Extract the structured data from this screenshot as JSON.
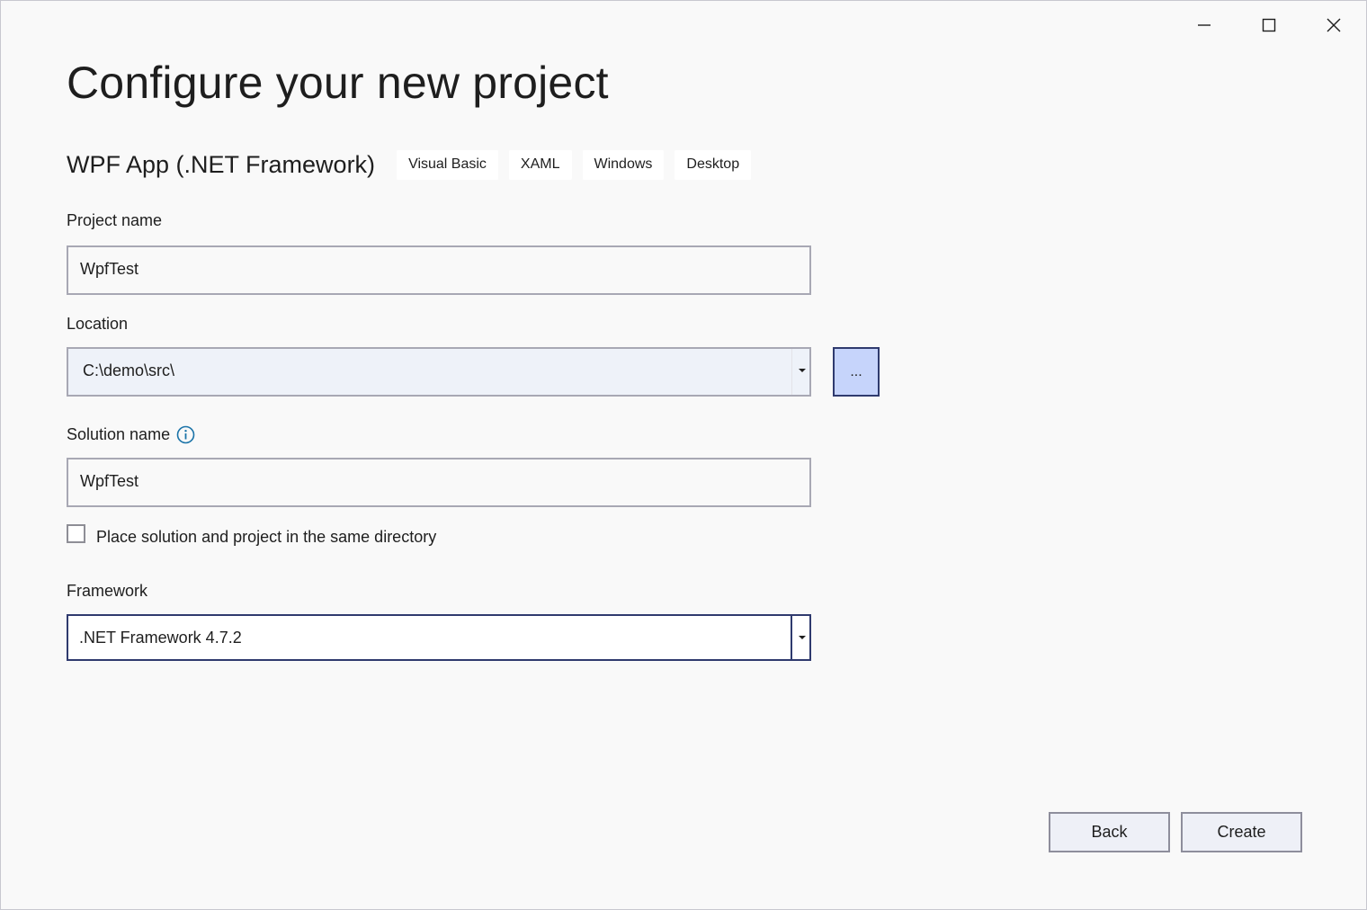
{
  "window": {
    "controls": {
      "minimize_icon": "minimize-icon",
      "maximize_icon": "maximize-icon",
      "close_icon": "close-icon"
    }
  },
  "header": {
    "title": "Configure your new project"
  },
  "template": {
    "name": "WPF App (.NET Framework)",
    "tags": [
      "Visual Basic",
      "XAML",
      "Windows",
      "Desktop"
    ]
  },
  "form": {
    "project_name": {
      "label": "Project name",
      "value": "WpfTest"
    },
    "location": {
      "label": "Location",
      "value": "C:\\demo\\src\\",
      "browse_label": "..."
    },
    "solution_name": {
      "label": "Solution name",
      "value": "WpfTest",
      "info_icon": "info-icon"
    },
    "same_directory": {
      "label": "Place solution and project in the same directory",
      "checked": false
    },
    "framework": {
      "label": "Framework",
      "value": ".NET Framework 4.7.2"
    }
  },
  "footer": {
    "back_label": "Back",
    "create_label": "Create"
  },
  "colors": {
    "background": "#f9f9f9",
    "accent_border": "#2f3a6e",
    "browse_fill": "#c6d4fb",
    "info_icon": "#1a73a8"
  }
}
